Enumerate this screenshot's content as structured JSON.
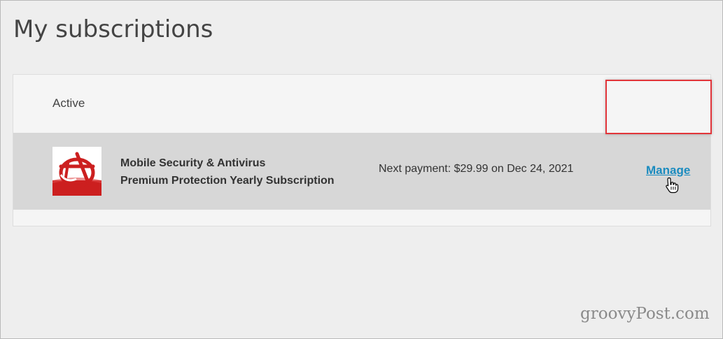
{
  "page": {
    "title": "My subscriptions"
  },
  "subscriptions": {
    "section_label": "Active",
    "items": [
      {
        "name_line1": "Mobile Security & Antivirus",
        "name_line2": "Premium Protection Yearly Subscription",
        "payment_text": "Next payment: $29.99 on Dec 24, 2021",
        "manage_label": "Manage",
        "icon": "trend-micro-logo-icon"
      }
    ]
  },
  "watermark": "groovyPost.com",
  "colors": {
    "background": "#eeeeee",
    "panel": "#f5f5f5",
    "row": "#d7d7d7",
    "link": "#1a8bbf",
    "highlight": "#e2353a",
    "icon_red": "#cc1f1f"
  }
}
